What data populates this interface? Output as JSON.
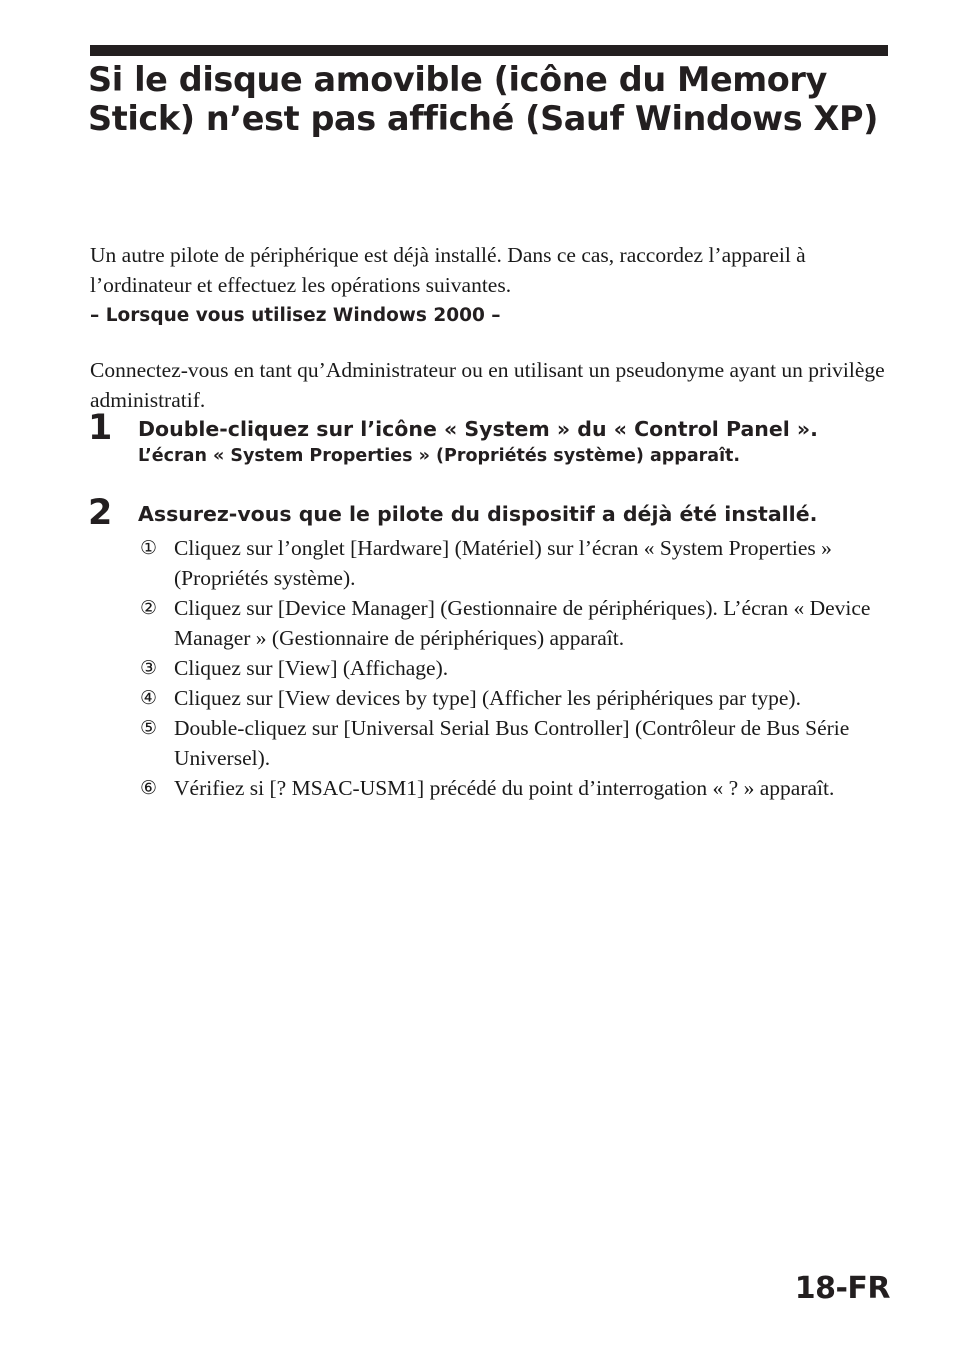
{
  "page": {
    "title": "Si le disque amovible (icône du Memory Stick) n’est pas affiché (Sauf Windows XP)",
    "footer_page_number": "18-FR",
    "rule_color": "#231f20",
    "text_color": "#1a1a1a",
    "background": "#ffffff"
  },
  "intro": {
    "paragraph": "Un autre pilote de périphérique est déjà installé. Dans ce cas, raccordez l’appareil à l’ordinateur et effectuez les opérations suivantes."
  },
  "section": {
    "heading": "– Lorsque vous utilisez Windows 2000 –",
    "body": "Connectez-vous en tant qu’Administrateur ou en utilisant un pseudonyme ayant un privilège administratif."
  },
  "steps": [
    {
      "number": "1",
      "title": "Double-cliquez sur l’icône « System » du « Control Panel ».",
      "note": "L’écran « System Properties » (Propriétés système) apparaît.",
      "substeps": []
    },
    {
      "number": "2",
      "title": "Assurez-vous que le pilote du dispositif a déjà été installé.",
      "note": "",
      "substeps": [
        {
          "marker": "①",
          "text": "Cliquez sur l’onglet [Hardware] (Matériel) sur l’écran « System Properties » (Propriétés système)."
        },
        {
          "marker": "②",
          "text": "Cliquez sur [Device Manager] (Gestionnaire de périphériques). L’écran « Device Manager » (Gestionnaire de périphériques) apparaît."
        },
        {
          "marker": "③",
          "text": "Cliquez sur [View] (Affichage)."
        },
        {
          "marker": "④",
          "text": "Cliquez sur [View devices by type] (Afficher les périphériques par type)."
        },
        {
          "marker": "⑤",
          "text": "Double-cliquez sur [Universal Serial Bus Controller] (Contrôleur de Bus Série Universel)."
        },
        {
          "marker": "⑥",
          "text": "Vérifiez si [? MSAC-USM1] précédé du point d’interrogation « ? » apparaît."
        }
      ]
    }
  ]
}
